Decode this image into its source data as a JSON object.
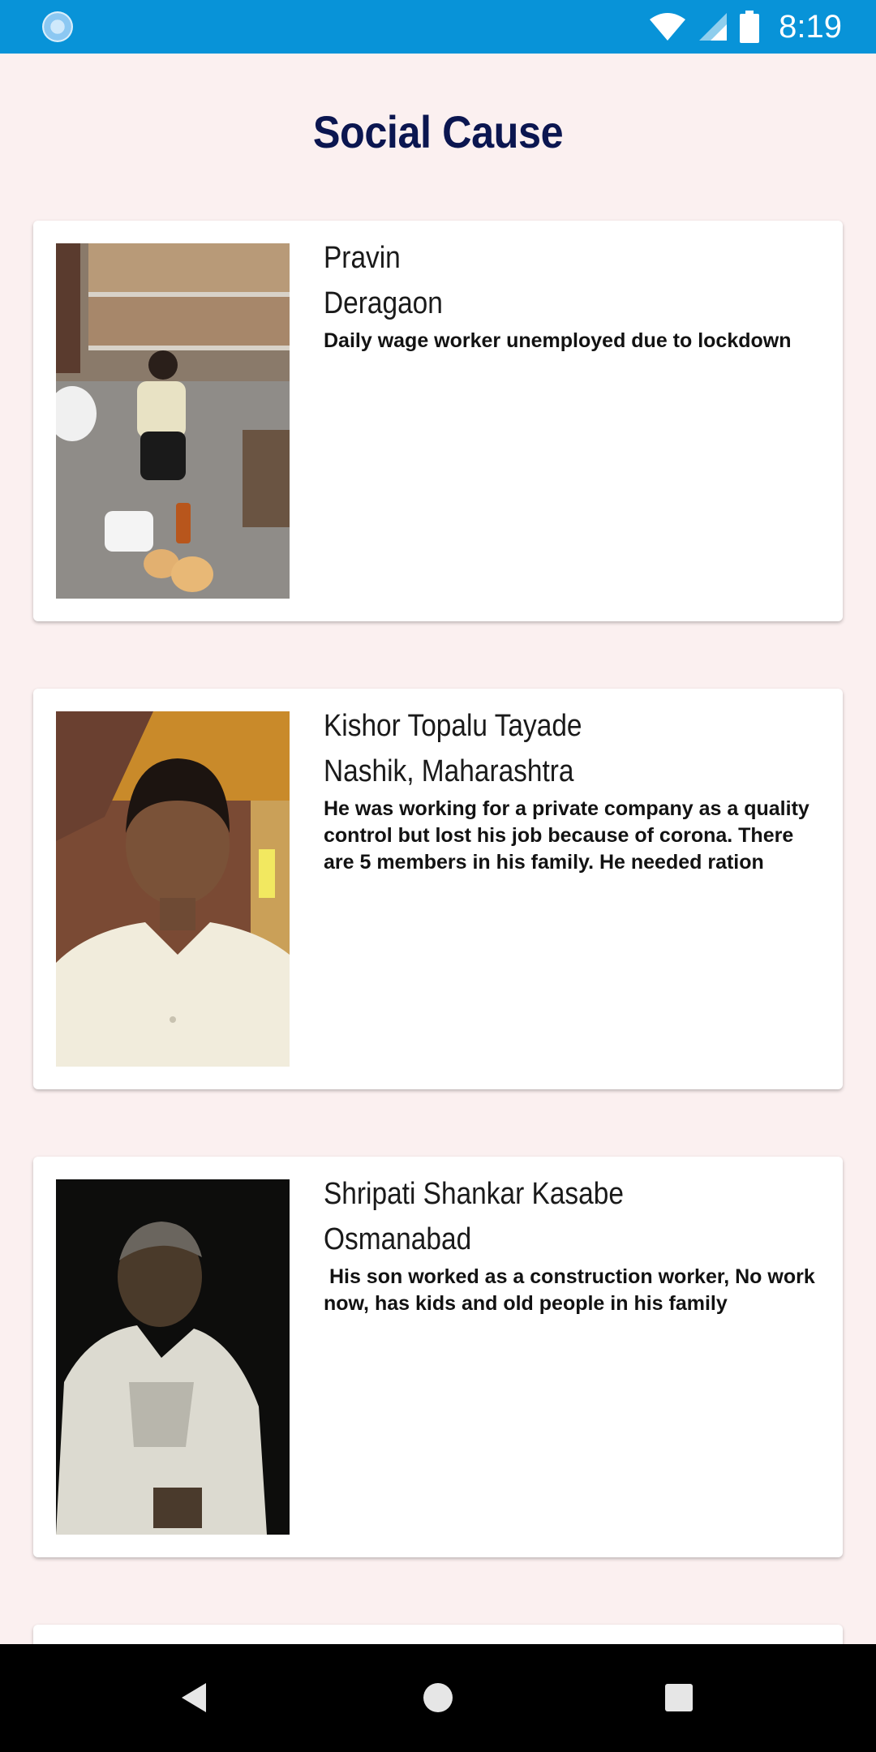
{
  "status_bar": {
    "time": "8:19",
    "icons": [
      "app-notification-icon",
      "wifi-icon",
      "cell-signal-icon",
      "battery-icon"
    ]
  },
  "page": {
    "title": "Social Cause"
  },
  "cards": [
    {
      "name": "Pravin",
      "location": "Deragaon",
      "description": "Daily wage worker unemployed due to lockdown"
    },
    {
      "name": "Kishor Topalu Tayade",
      "location": "Nashik, Maharashtra",
      "description": "He was working for a private company as a quality control but lost his job because of corona. There are 5 members in his family. He needed ration"
    },
    {
      "name": "Shripati Shankar Kasabe",
      "location": "Osmanabad",
      "description": " His son worked as a construction worker, No work now, has kids and old people in his family"
    }
  ],
  "nav_bar": {
    "icons": [
      "back-icon",
      "home-icon",
      "recents-icon"
    ]
  },
  "colors": {
    "status_bar": "#0893d8",
    "background": "#fbf0f0",
    "title": "#0b1650",
    "card": "#ffffff",
    "nav_bar": "#000000"
  }
}
